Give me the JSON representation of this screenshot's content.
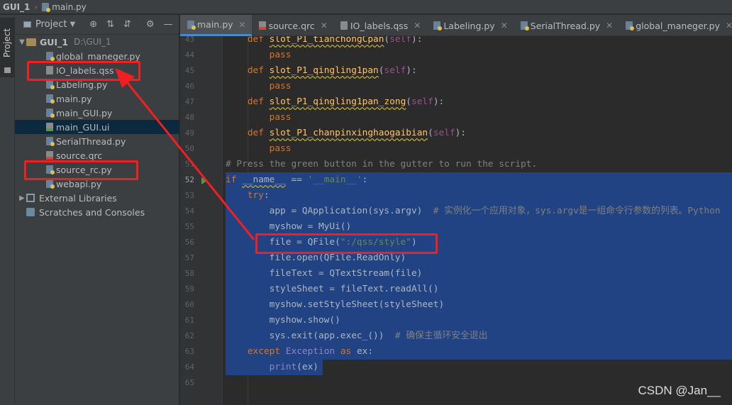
{
  "breadcrumb": {
    "project": "GUI_1",
    "file": "main.py"
  },
  "sidestripe": {
    "project_tab": "Project"
  },
  "project_panel": {
    "header_label": "Project",
    "root": {
      "name": "GUI_1",
      "path": "D:\\GUI_1"
    },
    "files": [
      {
        "name": "global_maneger.py",
        "icon": "python-file-icon"
      },
      {
        "name": "IO_labels.qss",
        "icon": "qss-file-icon"
      },
      {
        "name": "Labeling.py",
        "icon": "python-file-icon"
      },
      {
        "name": "main.py",
        "icon": "python-file-icon"
      },
      {
        "name": "main_GUI.py",
        "icon": "python-file-icon"
      },
      {
        "name": "main_GUI.ui",
        "icon": "ui-file-icon"
      },
      {
        "name": "SerialThread.py",
        "icon": "python-file-icon"
      },
      {
        "name": "source.qrc",
        "icon": "qrc-file-icon"
      },
      {
        "name": "source_rc.py",
        "icon": "python-file-icon"
      },
      {
        "name": "webapi.py",
        "icon": "python-file-icon"
      }
    ],
    "external_libraries": "External Libraries",
    "scratches": "Scratches and Consoles"
  },
  "tabs": [
    {
      "label": "main.py"
    },
    {
      "label": "source.qrc"
    },
    {
      "label": "IO_labels.qss"
    },
    {
      "label": "Labeling.py"
    },
    {
      "label": "SerialThread.py"
    },
    {
      "label": "global_maneger.py"
    }
  ],
  "editor": {
    "line_numbers": [
      "43",
      "44",
      "45",
      "46",
      "47",
      "48",
      "49",
      "50",
      "51",
      "52",
      "53",
      "54",
      "55",
      "56",
      "57",
      "58",
      "59",
      "60",
      "61",
      "62",
      "63",
      "64",
      "65"
    ]
  },
  "watermark": "CSDN @Jan__",
  "colors": {
    "selection": "#214283",
    "annotation": "#f02020",
    "keyword": "#cc7832",
    "function": "#ffc66d"
  }
}
